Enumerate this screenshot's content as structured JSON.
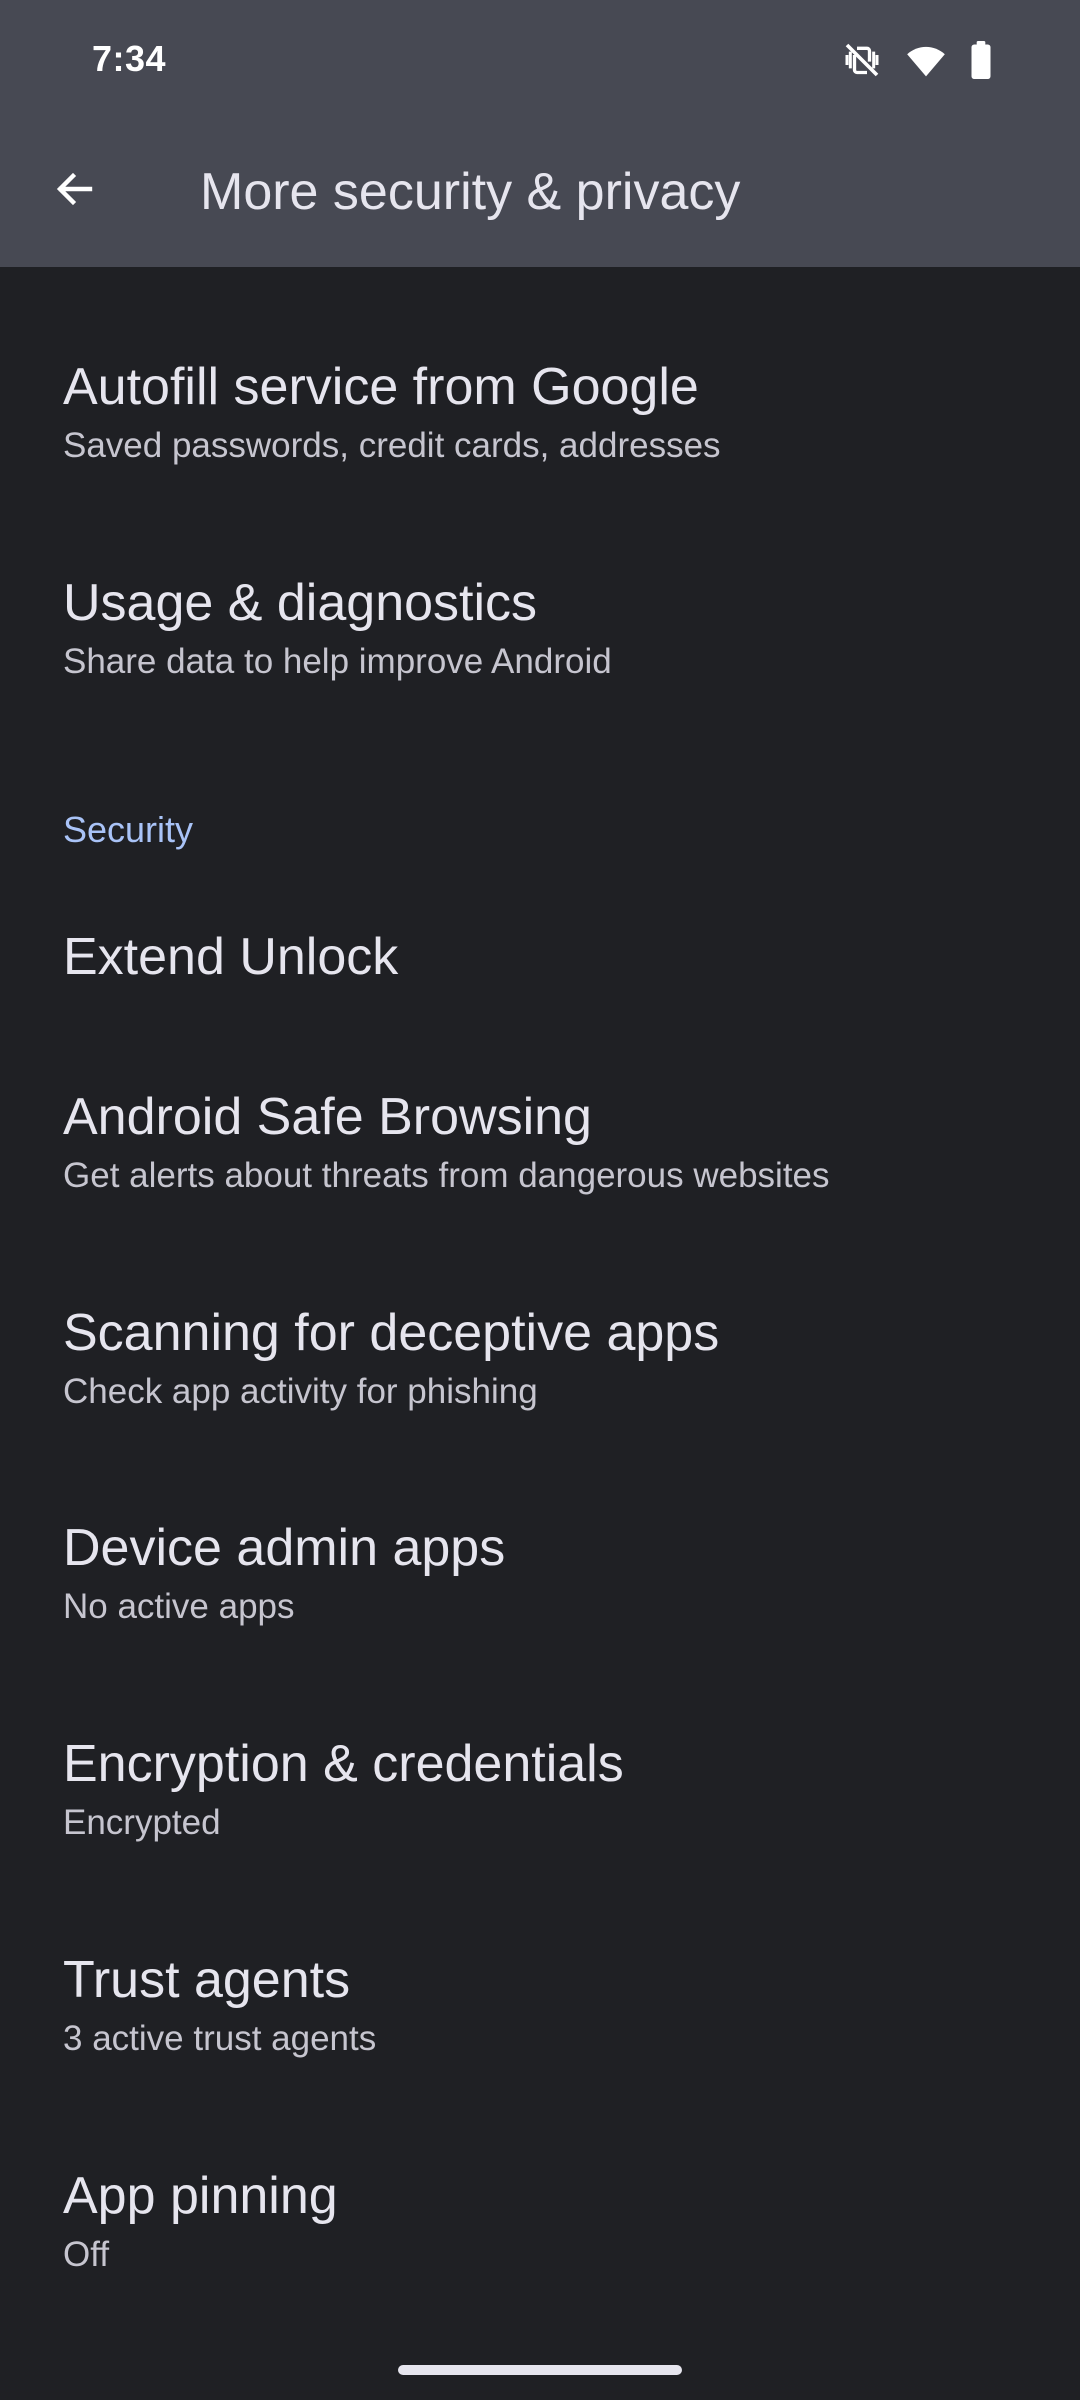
{
  "status_bar": {
    "time": "7:34",
    "icons": [
      "vibrate-off-icon",
      "wifi-icon",
      "battery-icon"
    ]
  },
  "app_bar": {
    "back_icon": "arrow-back-icon",
    "title": "More security & privacy"
  },
  "items_top": [
    {
      "title": "Autofill service from Google",
      "subtitle": "Saved passwords, credit cards, addresses"
    },
    {
      "title": "Usage & diagnostics",
      "subtitle": "Share data to help improve Android"
    }
  ],
  "security_section": {
    "label": "Security",
    "items": [
      {
        "title": "Extend Unlock"
      },
      {
        "title": "Android Safe Browsing",
        "subtitle": "Get alerts about threats from dangerous websites"
      },
      {
        "title": "Scanning for deceptive apps",
        "subtitle": "Check app activity for phishing"
      },
      {
        "title": "Device admin apps",
        "subtitle": "No active apps"
      },
      {
        "title": "Encryption & credentials",
        "subtitle": "Encrypted"
      },
      {
        "title": "Trust agents",
        "subtitle": "3 active trust agents"
      },
      {
        "title": "App pinning",
        "subtitle": "Off"
      }
    ]
  },
  "colors": {
    "header_bg": "#474953",
    "page_bg": "#1f2024",
    "accent": "#a9c3f7"
  }
}
